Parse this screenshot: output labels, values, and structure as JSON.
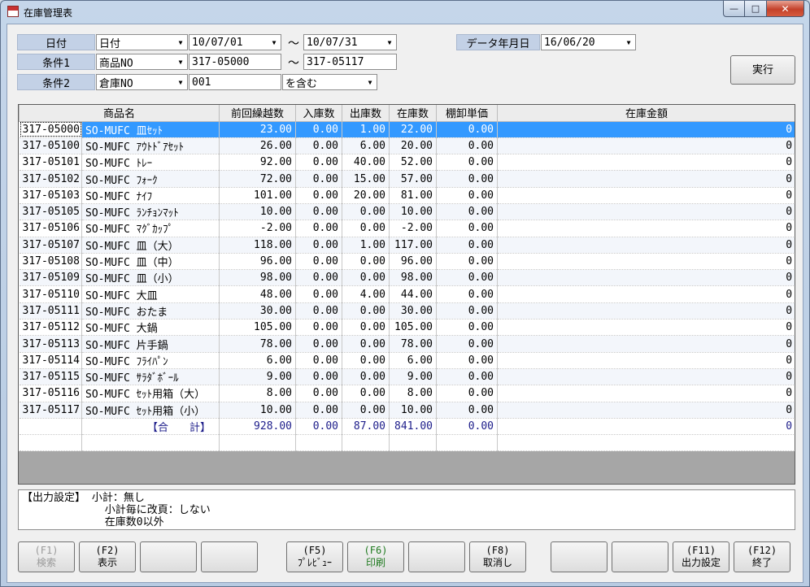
{
  "window": {
    "title": "在庫管理表",
    "min": "—",
    "max": "□",
    "close": "✕"
  },
  "filters": {
    "date_label": "日付",
    "date_field": "日付",
    "date_from": "10/07/01",
    "date_to": "10/07/31",
    "cond1_label": "条件1",
    "cond1_field": "商品NO",
    "cond1_from": "317-05000",
    "cond1_to": "317-05117",
    "cond2_label": "条件2",
    "cond2_field": "倉庫NO",
    "cond2_value": "001",
    "cond2_op": "を含む",
    "tilde": "～",
    "data_date_label": "データ年月日",
    "data_date": "16/06/20",
    "run_label": "実行"
  },
  "table": {
    "headers": [
      "商品名",
      "前回繰越数",
      "入庫数",
      "出庫数",
      "在庫数",
      "棚卸単価",
      "在庫金額"
    ],
    "rows": [
      [
        "317-05000",
        "SO-MUFC 皿ｾｯﾄ",
        "23.00",
        "0.00",
        "1.00",
        "22.00",
        "0.00",
        "0"
      ],
      [
        "317-05100",
        "SO-MUFC ｱｳﾄﾄﾞｱｾｯﾄ",
        "26.00",
        "0.00",
        "6.00",
        "20.00",
        "0.00",
        "0"
      ],
      [
        "317-05101",
        "SO-MUFC ﾄﾚｰ",
        "92.00",
        "0.00",
        "40.00",
        "52.00",
        "0.00",
        "0"
      ],
      [
        "317-05102",
        "SO-MUFC ﾌｫｰｸ",
        "72.00",
        "0.00",
        "15.00",
        "57.00",
        "0.00",
        "0"
      ],
      [
        "317-05103",
        "SO-MUFC ﾅｲﾌ",
        "101.00",
        "0.00",
        "20.00",
        "81.00",
        "0.00",
        "0"
      ],
      [
        "317-05105",
        "SO-MUFC ﾗﾝﾁｮﾝﾏｯﾄ",
        "10.00",
        "0.00",
        "0.00",
        "10.00",
        "0.00",
        "0"
      ],
      [
        "317-05106",
        "SO-MUFC ﾏｸﾞｶｯﾌﾟ",
        "-2.00",
        "0.00",
        "0.00",
        "-2.00",
        "0.00",
        "0"
      ],
      [
        "317-05107",
        "SO-MUFC 皿（大）",
        "118.00",
        "0.00",
        "1.00",
        "117.00",
        "0.00",
        "0"
      ],
      [
        "317-05108",
        "SO-MUFC 皿（中）",
        "96.00",
        "0.00",
        "0.00",
        "96.00",
        "0.00",
        "0"
      ],
      [
        "317-05109",
        "SO-MUFC 皿（小）",
        "98.00",
        "0.00",
        "0.00",
        "98.00",
        "0.00",
        "0"
      ],
      [
        "317-05110",
        "SO-MUFC 大皿",
        "48.00",
        "0.00",
        "4.00",
        "44.00",
        "0.00",
        "0"
      ],
      [
        "317-05111",
        "SO-MUFC おたま",
        "30.00",
        "0.00",
        "0.00",
        "30.00",
        "0.00",
        "0"
      ],
      [
        "317-05112",
        "SO-MUFC 大鍋",
        "105.00",
        "0.00",
        "0.00",
        "105.00",
        "0.00",
        "0"
      ],
      [
        "317-05113",
        "SO-MUFC 片手鍋",
        "78.00",
        "0.00",
        "0.00",
        "78.00",
        "0.00",
        "0"
      ],
      [
        "317-05114",
        "SO-MUFC ﾌﾗｲﾊﾟﾝ",
        "6.00",
        "0.00",
        "0.00",
        "6.00",
        "0.00",
        "0"
      ],
      [
        "317-05115",
        "SO-MUFC ｻﾗﾀﾞﾎﾞｰﾙ",
        "9.00",
        "0.00",
        "0.00",
        "9.00",
        "0.00",
        "0"
      ],
      [
        "317-05116",
        "SO-MUFC ｾｯﾄ用箱（大）",
        "8.00",
        "0.00",
        "0.00",
        "8.00",
        "0.00",
        "0"
      ],
      [
        "317-05117",
        "SO-MUFC ｾｯﾄ用箱（小）",
        "10.00",
        "0.00",
        "0.00",
        "10.00",
        "0.00",
        "0"
      ]
    ],
    "total": [
      "【合　　計】",
      "928.00",
      "0.00",
      "87.00",
      "841.00",
      "0.00",
      "0"
    ],
    "selected_row": 0
  },
  "output_settings": {
    "line1": "【出力設定】 小計：無し",
    "line2": "             小計毎に改頁：しない",
    "line3": "             在庫数0以外"
  },
  "function_keys": [
    {
      "key": "(F1)",
      "label": "検索",
      "state": "disabled"
    },
    {
      "key": "(F2)",
      "label": "表示",
      "state": "normal"
    },
    {
      "key": "",
      "label": "",
      "state": "empty"
    },
    {
      "key": "",
      "label": "",
      "state": "empty"
    },
    {
      "key": "(F5)",
      "label": "ﾌﾟﾚﾋﾞｭｰ",
      "state": "normal"
    },
    {
      "key": "(F6)",
      "label": "印刷",
      "state": "green"
    },
    {
      "key": "",
      "label": "",
      "state": "empty"
    },
    {
      "key": "(F8)",
      "label": "取消し",
      "state": "normal"
    },
    {
      "key": "",
      "label": "",
      "state": "empty"
    },
    {
      "key": "",
      "label": "",
      "state": "empty"
    },
    {
      "key": "(F11)",
      "label": "出力設定",
      "state": "normal"
    },
    {
      "key": "(F12)",
      "label": "終了",
      "state": "normal"
    }
  ],
  "colors": {
    "accent_selection": "#3399ff",
    "label_bg": "#c3d1e6",
    "total_text": "#1d1d8a",
    "f6_text": "#1f7a1f"
  }
}
